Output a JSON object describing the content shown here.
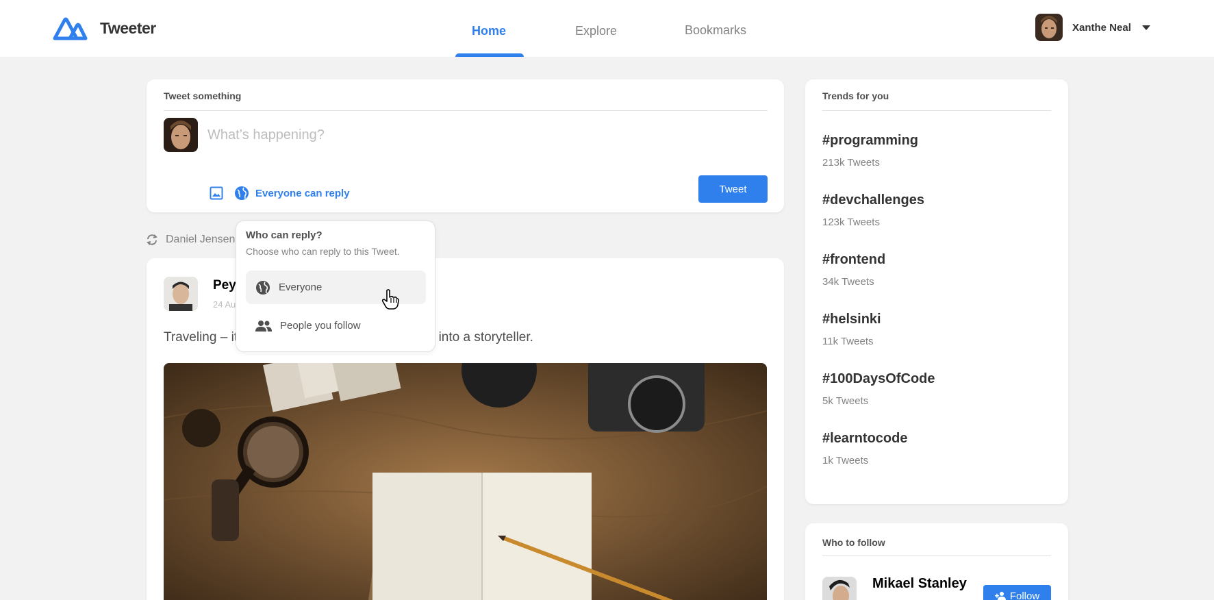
{
  "header": {
    "brand": "Tweeter",
    "nav": [
      {
        "label": "Home",
        "active": true
      },
      {
        "label": "Explore",
        "active": false
      },
      {
        "label": "Bookmarks",
        "active": false
      }
    ],
    "user_name": "Xanthe Neal"
  },
  "composer": {
    "title": "Tweet something",
    "placeholder": "What’s happening?",
    "reply_setting": "Everyone can reply",
    "tweet_button": "Tweet"
  },
  "reply_popup": {
    "title": "Who can reply?",
    "subtitle": "Choose who can reply to this Tweet.",
    "options": [
      {
        "label": "Everyone",
        "icon": "globe-icon",
        "hovered": true
      },
      {
        "label": "People you follow",
        "icon": "people-icon",
        "hovered": false
      }
    ]
  },
  "feed": {
    "retweeted_by": "Daniel Jensen",
    "post": {
      "author": "Pey",
      "date": "24 Au",
      "text": "Traveling – it                                              s you into a storyteller."
    }
  },
  "trends": {
    "title": "Trends for you",
    "items": [
      {
        "tag": "#programming",
        "count": "213k Tweets"
      },
      {
        "tag": "#devchallenges",
        "count": "123k Tweets"
      },
      {
        "tag": "#frontend",
        "count": "34k Tweets"
      },
      {
        "tag": "#helsinki",
        "count": "11k Tweets"
      },
      {
        "tag": "#100DaysOfCode",
        "count": "5k Tweets"
      },
      {
        "tag": "#learntocode",
        "count": "1k Tweets"
      }
    ]
  },
  "who_to_follow": {
    "title": "Who to follow",
    "name": "Mikael Stanley",
    "button": "Follow"
  },
  "colors": {
    "accent": "#2F80ED",
    "background": "#F2F2F2"
  }
}
